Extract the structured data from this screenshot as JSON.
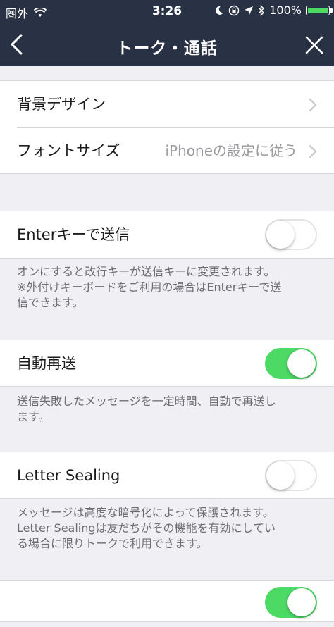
{
  "status_bar": {
    "carrier": "圏外",
    "time": "3:26",
    "battery_percent": "100%",
    "icons": [
      "wifi-icon",
      "moon-icon",
      "rotation-lock-icon",
      "location-icon",
      "bluetooth-icon",
      "battery-icon"
    ]
  },
  "nav": {
    "title": "トーク・通話",
    "back_icon": "chevron-left-icon",
    "close_icon": "close-icon"
  },
  "section1": {
    "background_design": {
      "label": "背景デザイン"
    },
    "font_size": {
      "label": "フォントサイズ",
      "value": "iPhoneの設定に従う"
    }
  },
  "enter_send": {
    "label": "Enterキーで送信",
    "enabled": false,
    "note_line1": "オンにすると改行キーが送信キーに変更されます。",
    "note_line2": "※外付けキーボードをご利用の場合はEnterキーで送",
    "note_line3": "信できます。"
  },
  "auto_resend": {
    "label": "自動再送",
    "enabled": true,
    "note_line1": "送信失敗したメッセージを一定時間、自動で再送し",
    "note_line2": "ます。"
  },
  "letter_sealing": {
    "label": "Letter Sealing",
    "enabled": false,
    "note_line1": "メッセージは高度な暗号化によって保護されます。",
    "note_line2": "Letter Sealingは友だちがその機能を有効にしてい",
    "note_line3": "る場合に限りトークで利用できます。"
  },
  "next_row": {
    "enabled": true
  },
  "colors": {
    "header_bg": "#293145",
    "page_bg": "#efeff4",
    "toggle_on": "#4cd964",
    "note_text": "#6d6d72"
  }
}
